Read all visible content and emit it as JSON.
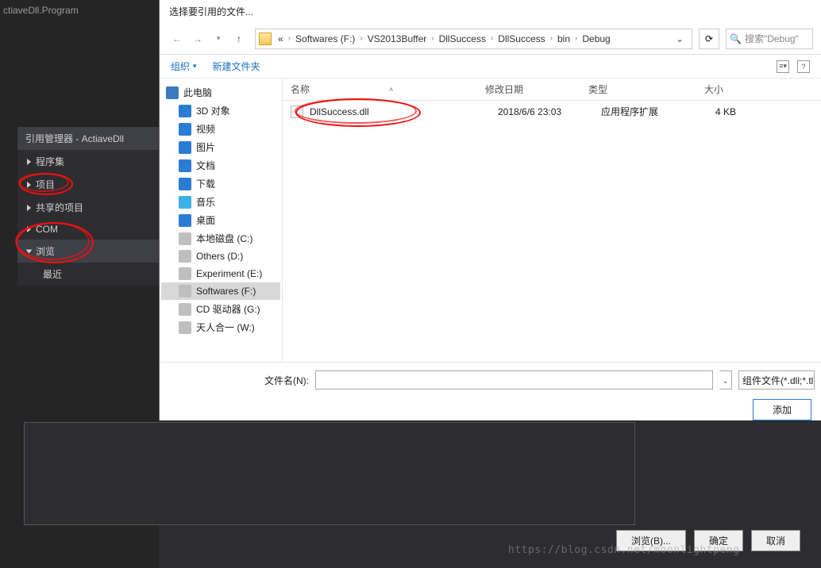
{
  "vs": {
    "bg_tab": "ctiaveDll.Program",
    "ref_title": "引用管理器 - ActiaveDll",
    "items": [
      {
        "label": "程序集",
        "selected": false,
        "expandable": true
      },
      {
        "label": "项目",
        "selected": false,
        "expandable": true
      },
      {
        "label": "共享的项目",
        "selected": false,
        "expandable": true
      },
      {
        "label": "COM",
        "selected": false,
        "expandable": true
      },
      {
        "label": "浏览",
        "selected": true,
        "expandable": true,
        "open": true
      }
    ],
    "sub_item": "最近",
    "browse_btn": "浏览(B)...",
    "ok_btn": "确定",
    "cancel_btn": "取消"
  },
  "dialog": {
    "title": "选择要引用的文件...",
    "crumbs": [
      "Softwares (F:)",
      "VS2013Buffer",
      "DllSuccess",
      "DllSuccess",
      "bin",
      "Debug"
    ],
    "crumb_prefix": "«",
    "search_placeholder": "搜索\"Debug\"",
    "toolbar": {
      "organize": "组织",
      "newfolder": "新建文件夹"
    },
    "tree_root": "此电脑",
    "tree": [
      {
        "label": "3D 对象",
        "ico": "blue"
      },
      {
        "label": "视频",
        "ico": "blue"
      },
      {
        "label": "图片",
        "ico": "blue"
      },
      {
        "label": "文档",
        "ico": "blue"
      },
      {
        "label": "下载",
        "ico": "blue"
      },
      {
        "label": "音乐",
        "ico": "music"
      },
      {
        "label": "桌面",
        "ico": "blue"
      },
      {
        "label": "本地磁盘 (C:)",
        "ico": "disk"
      },
      {
        "label": "Others (D:)",
        "ico": "disk"
      },
      {
        "label": "Experiment (E:)",
        "ico": "disk"
      },
      {
        "label": "Softwares (F:)",
        "ico": "disk",
        "sel": true
      },
      {
        "label": "CD 驱动器 (G:)",
        "ico": "disk"
      },
      {
        "label": "天人合一 (W:)",
        "ico": "disk"
      }
    ],
    "columns": {
      "name": "名称",
      "date": "修改日期",
      "type": "类型",
      "size": "大小"
    },
    "files": [
      {
        "name": "DllSuccess.dll",
        "date": "2018/6/6 23:03",
        "type": "应用程序扩展",
        "size": "4 KB"
      }
    ],
    "filename_label": "文件名(N):",
    "filter": "组件文件(*.dll;*.tl",
    "add_btn": "添加"
  },
  "watermark": "https://blog.csdn.net/moonlightpeng"
}
